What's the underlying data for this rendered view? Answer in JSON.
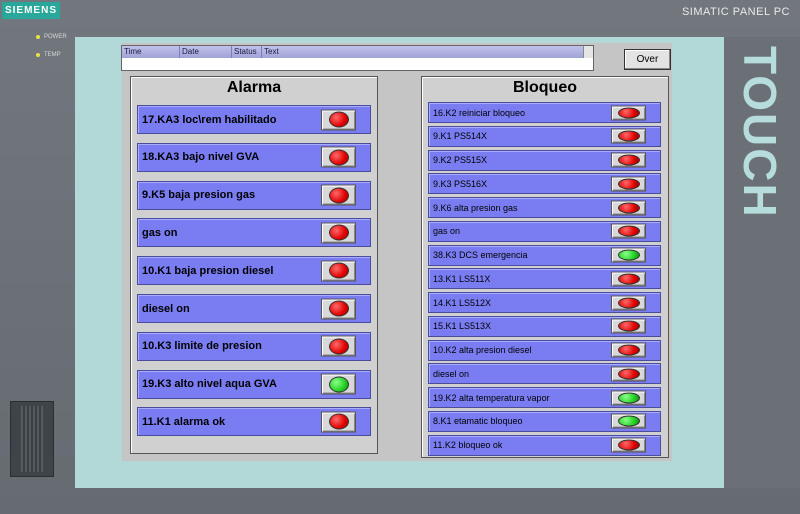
{
  "device": {
    "brand": "SIEMENS",
    "model": "SIMATIC PANEL PC",
    "leds": [
      {
        "label": "POWER",
        "color": "#e8e24a"
      },
      {
        "label": "TEMP",
        "color": "#e8e24a"
      }
    ],
    "side_text": "TOUCH"
  },
  "alarm_view": {
    "columns": [
      "Time",
      "Date",
      "Status",
      "Text"
    ]
  },
  "over_button": {
    "label": "Over"
  },
  "alarma": {
    "title": "Alarma",
    "items": [
      {
        "label": "17.KA3 loc\\rem habilitado",
        "status": "red"
      },
      {
        "label": "18.KA3 bajo nivel GVA",
        "status": "red"
      },
      {
        "label": "9.K5 baja presion gas",
        "status": "red"
      },
      {
        "label": "gas on",
        "status": "red"
      },
      {
        "label": "10.K1 baja presion diesel",
        "status": "red"
      },
      {
        "label": "diesel on",
        "status": "red"
      },
      {
        "label": "10.K3 limite de presion",
        "status": "red"
      },
      {
        "label": "19.K3 alto nivel aqua GVA",
        "status": "green"
      },
      {
        "label": "11.K1 alarma ok",
        "status": "red"
      }
    ]
  },
  "bloqueo": {
    "title": "Bloqueo",
    "items": [
      {
        "label": "16.K2 reiniciar bloqueo",
        "status": "red"
      },
      {
        "label": "9.K1 PS514X",
        "status": "red"
      },
      {
        "label": "9.K2 PS515X",
        "status": "red"
      },
      {
        "label": "9.K3 PS516X",
        "status": "red"
      },
      {
        "label": "9.K6 alta presion gas",
        "status": "red"
      },
      {
        "label": "gas on",
        "status": "red"
      },
      {
        "label": "38.K3 DCS emergencia",
        "status": "green"
      },
      {
        "label": "13.K1 LS511X",
        "status": "red"
      },
      {
        "label": "14.K1 LS512X",
        "status": "red"
      },
      {
        "label": "15.K1 LS513X",
        "status": "red"
      },
      {
        "label": "10.K2 alta presion diesel",
        "status": "red"
      },
      {
        "label": "diesel on",
        "status": "red"
      },
      {
        "label": "19.K2 alta temperatura vapor",
        "status": "green"
      },
      {
        "label": "8.K1 etamatic bloqueo",
        "status": "green"
      },
      {
        "label": "11.K2 bloqueo ok",
        "status": "red"
      }
    ]
  },
  "colors": {
    "row_fill": "#7a7df2",
    "lamp_red": "#e00000",
    "lamp_green": "#22d022",
    "screen_bg": "#b3d8d8",
    "brand_teal": "#2aa79b"
  }
}
